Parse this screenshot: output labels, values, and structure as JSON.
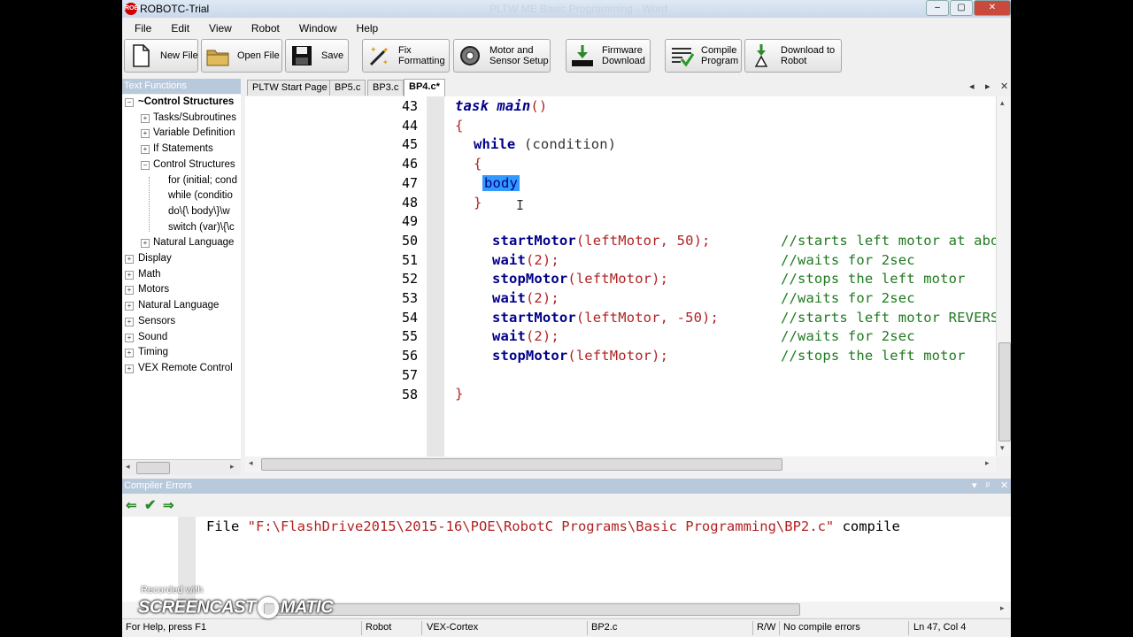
{
  "window": {
    "title": "ROBOTC-Trial",
    "ghost_title": "PLTW ME Basic Programming - Word",
    "app_icon_text": "ROBOT",
    "controls": [
      "–",
      "▢",
      "✕"
    ]
  },
  "menu": [
    "File",
    "Edit",
    "View",
    "Robot",
    "Window",
    "Help"
  ],
  "toolbar": {
    "new_file": "New File",
    "open_file": "Open File",
    "save": "Save",
    "fix_formatting": "Fix\nFormatting",
    "motor_sensor_setup": "Motor and\nSensor Setup",
    "firmware_download": "Firmware\nDownload",
    "compile_program": "Compile\nProgram",
    "download_to_robot": "Download to\nRobot"
  },
  "text_functions": {
    "header": "Text Functions",
    "items": [
      {
        "label": "~Control Structures",
        "level": 0,
        "bold": true,
        "expander": "−"
      },
      {
        "label": "Tasks/Subroutines",
        "level": 1,
        "expander": "+"
      },
      {
        "label": "Variable Definition",
        "level": 1,
        "expander": "+"
      },
      {
        "label": "If Statements",
        "level": 1,
        "expander": "+"
      },
      {
        "label": "Control Structures",
        "level": 1,
        "expander": "−"
      },
      {
        "label": "for (initial; cond",
        "level": 2
      },
      {
        "label": "while (conditio",
        "level": 2
      },
      {
        "label": "do\\{\\  body\\}\\w",
        "level": 2
      },
      {
        "label": "switch (var)\\{\\c",
        "level": 2
      },
      {
        "label": "Natural Language",
        "level": 1,
        "expander": "+"
      },
      {
        "label": "Display",
        "level": 0,
        "expander": "+"
      },
      {
        "label": "Math",
        "level": 0,
        "expander": "+"
      },
      {
        "label": "Motors",
        "level": 0,
        "expander": "+"
      },
      {
        "label": "Natural Language",
        "level": 0,
        "expander": "+"
      },
      {
        "label": "Sensors",
        "level": 0,
        "expander": "+"
      },
      {
        "label": "Sound",
        "level": 0,
        "expander": "+"
      },
      {
        "label": "Timing",
        "level": 0,
        "expander": "+"
      },
      {
        "label": "VEX Remote Control",
        "level": 0,
        "expander": "+"
      }
    ]
  },
  "tabs": [
    {
      "label": "PLTW Start Page",
      "active": false
    },
    {
      "label": "BP5.c",
      "active": false
    },
    {
      "label": "BP3.c",
      "active": false
    },
    {
      "label": "BP4.c*",
      "active": true
    }
  ],
  "tab_controls": [
    "◂",
    "▸",
    "✕"
  ],
  "editor": {
    "lines": [
      {
        "n": "43"
      },
      {
        "n": "44"
      },
      {
        "n": "45"
      },
      {
        "n": "46"
      },
      {
        "n": "47"
      },
      {
        "n": "48"
      },
      {
        "n": "49"
      },
      {
        "n": "50"
      },
      {
        "n": "51"
      },
      {
        "n": "52"
      },
      {
        "n": "53"
      },
      {
        "n": "54"
      },
      {
        "n": "55"
      },
      {
        "n": "56"
      },
      {
        "n": "57"
      },
      {
        "n": "58"
      }
    ],
    "code": {
      "l43_kw": "task",
      "l43_fn": "main",
      "l43_paren": "()",
      "l44": "{",
      "l45_kw": "while",
      "l45_rest": " (condition)",
      "l46": "{",
      "l47": "body",
      "l48": "}",
      "l50_fn": "startMotor",
      "l50_args": "(leftMotor, 50);",
      "l50_cm": "//starts left motor at about half sp",
      "l51_fn": "wait",
      "l51_args": "(2);",
      "l51_cm": "//waits for 2sec",
      "l52_fn": "stopMotor",
      "l52_args": "(leftMotor);",
      "l52_cm": "//stops the left motor",
      "l53_fn": "wait",
      "l53_args": "(2);",
      "l53_cm": "//waits for 2sec",
      "l54_fn": "startMotor",
      "l54_args": "(leftMotor, -50);",
      "l54_cm": "//starts left motor REVERSE at about",
      "l55_fn": "wait",
      "l55_args": "(2);",
      "l55_cm": "//waits for 2sec",
      "l56_fn": "stopMotor",
      "l56_args": "(leftMotor);",
      "l56_cm": "//stops the left motor",
      "l58": "}"
    }
  },
  "compiler": {
    "header": "Compiler Errors",
    "header_controls": [
      "▾",
      "ᵖ",
      "✕"
    ],
    "prefix": "File ",
    "path": "\"F:\\FlashDrive2015\\2015-16\\POE\\RobotC Programs\\Basic Programming\\BP2.c\"",
    "suffix": " compile"
  },
  "status": {
    "help": "For Help, press F1",
    "robot": "Robot",
    "platform": "VEX-Cortex",
    "file": "BP2.c",
    "rw": "R/W",
    "errors": "No compile errors",
    "position": "Ln 47, Col 4"
  },
  "watermark": {
    "line1": "Recorded with",
    "left": "SCREENCAST",
    "right": "MATIC"
  },
  "colors": {
    "keyword": "#00008b",
    "comment": "#1f7a1f",
    "literal": "#b22222",
    "selection": "#3399ff",
    "panel_header": "#b9c9dc"
  }
}
